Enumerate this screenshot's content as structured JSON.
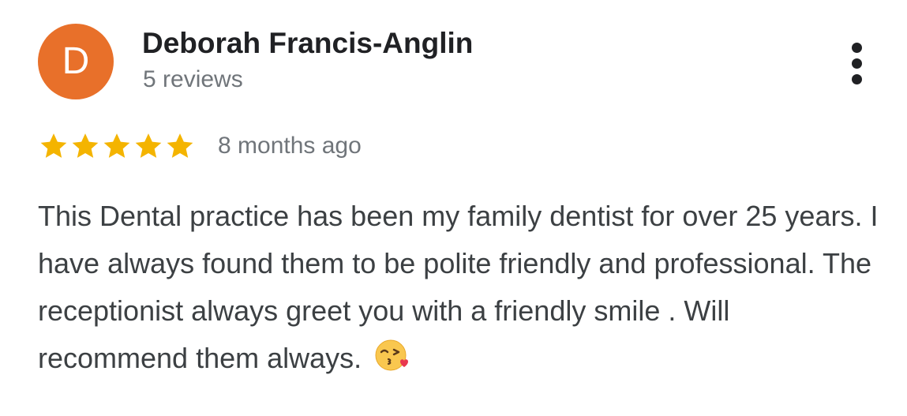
{
  "reviewer": {
    "avatar_initial": "D",
    "avatar_color": "#e8702a",
    "name": "Deborah Francis-Anglin",
    "review_count": "5 reviews"
  },
  "menu": {
    "icon": "more-vert-icon"
  },
  "review": {
    "rating": 5,
    "rating_max": 5,
    "star_color": "#f4b400",
    "timestamp": "8 months ago",
    "text": "This Dental practice has been my family dentist for over 25 years. I have always found them to be polite friendly and professional. The receptionist always greet you with a friendly smile . Will recommend them always.",
    "emoji": "face-throwing-kiss-emoji"
  }
}
